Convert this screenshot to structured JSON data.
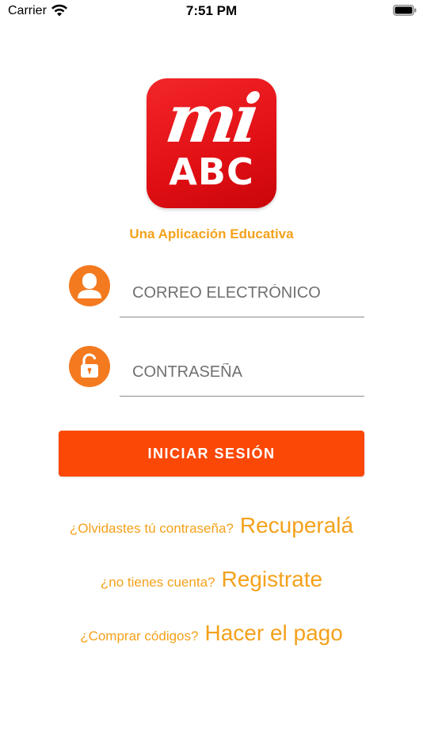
{
  "status_bar": {
    "carrier": "Carrier",
    "time": "7:51 PM",
    "icons": [
      "wifi-icon",
      "battery-icon"
    ]
  },
  "logo": {
    "line1": "mi",
    "line2": "ABC"
  },
  "tagline": "Una Aplicación Educativa",
  "login_form": {
    "email_placeholder": "CORREO ELECTRÓNICO",
    "email_value": "",
    "password_placeholder": "CONTRASEÑA",
    "password_value": "",
    "submit_label": "INICIAR SESIÓN"
  },
  "links": {
    "recover_prompt": "¿Olvidastes tú contraseña?",
    "recover_action": "Recuperalá",
    "register_prompt": "¿no tienes cuenta?",
    "register_action": "Registrate",
    "buy_prompt": "¿Comprar códigos?",
    "buy_action": "Hacer el pago"
  },
  "colors": {
    "accent_orange": "#f47a20",
    "button_red_orange": "#fb4807",
    "link_yellow_orange": "#f4a11b",
    "logo_red": "#e00f14"
  }
}
